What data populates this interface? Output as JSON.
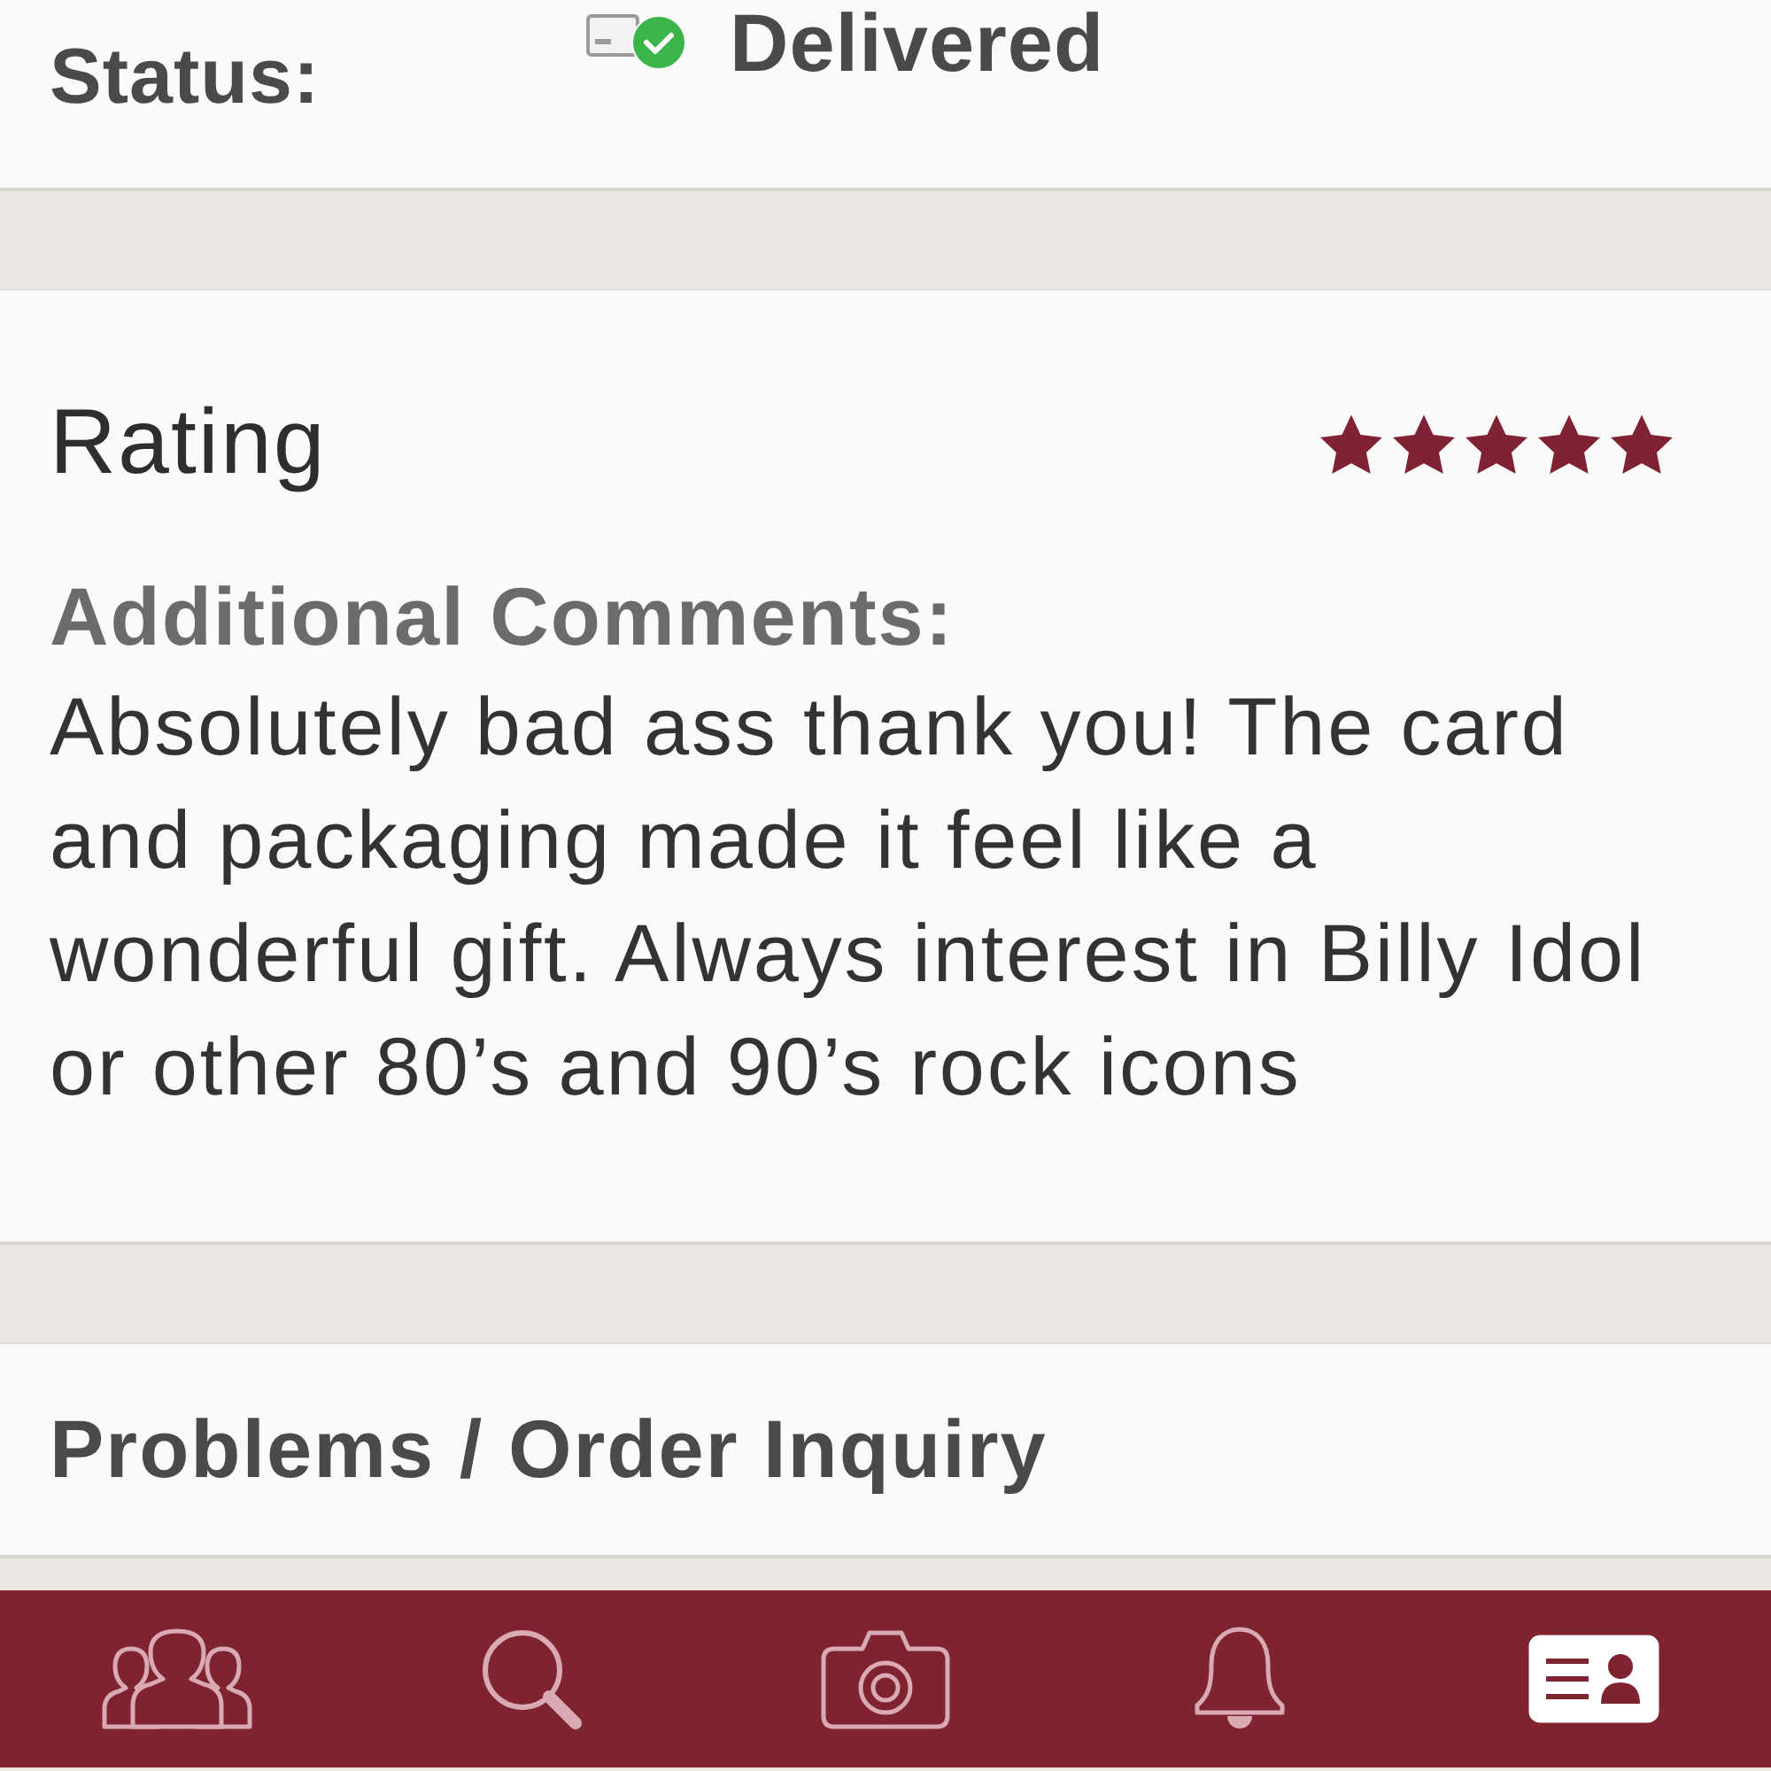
{
  "status": {
    "label": "Status:",
    "value": "Delivered"
  },
  "rating": {
    "title": "Rating",
    "stars": 5,
    "comments_label": "Additional Comments:",
    "comments": "Absolutely bad ass thank you! The card and packaging made it feel like a wonderful gift. Always interest in Billy Idol or other 80’s and 90’s rock icons"
  },
  "problems": {
    "label": "Problems / Order Inquiry"
  },
  "tab_bar": {
    "tabs": [
      {
        "selected": false
      },
      {
        "selected": false
      },
      {
        "selected": false
      },
      {
        "selected": false
      },
      {
        "selected": true
      }
    ]
  }
}
